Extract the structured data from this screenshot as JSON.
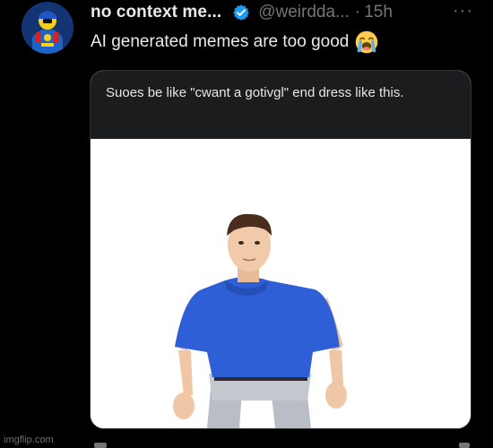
{
  "post": {
    "display_name": "no context me...",
    "handle": "@weirdda...",
    "separator": "·",
    "time": "15h",
    "more_label": "···",
    "text": "AI generated memes are too good",
    "emoji": "loudly-crying-face-icon"
  },
  "media": {
    "caption": "Suoes be like \"cwant a gotivgl\" end dress like this."
  },
  "watermark": "imgflip.com",
  "colors": {
    "background": "#000000",
    "text_primary": "#e7e9ea",
    "text_secondary": "#71767b",
    "verified_blue": "#1d9bf0",
    "shirt_blue": "#2f5fd6"
  }
}
